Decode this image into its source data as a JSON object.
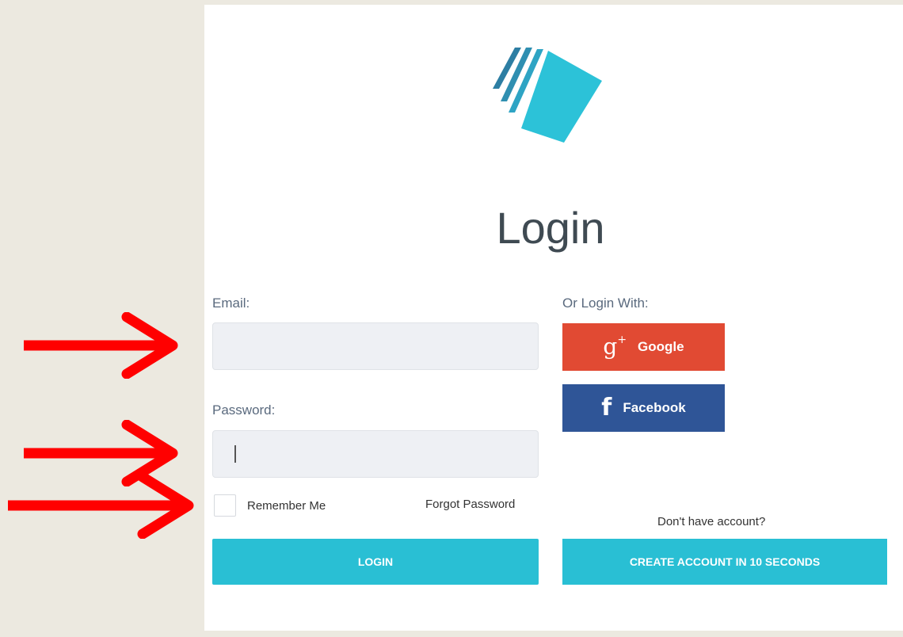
{
  "title": "Login",
  "colors": {
    "accent": "#29bfd4",
    "google": "#e14a33",
    "facebook": "#2f5597",
    "annotation_arrow": "#ff0000"
  },
  "form": {
    "email_label": "Email:",
    "email_value": "",
    "password_label": "Password:",
    "password_value": "",
    "remember_label": "Remember Me",
    "forgot_label": "Forgot Password",
    "login_button": "LOGIN"
  },
  "social": {
    "or_login_label": "Or Login With:",
    "google_icon": "g+",
    "google_label": "Google",
    "facebook_icon": "f",
    "facebook_label": "Facebook"
  },
  "signup": {
    "prompt": "Don't have account?",
    "create_button": "CREATE ACCOUNT IN 10 SECONDS"
  },
  "icons": {
    "logo": "stacked-stripes-logo",
    "annotation": "red-arrow-icon"
  }
}
